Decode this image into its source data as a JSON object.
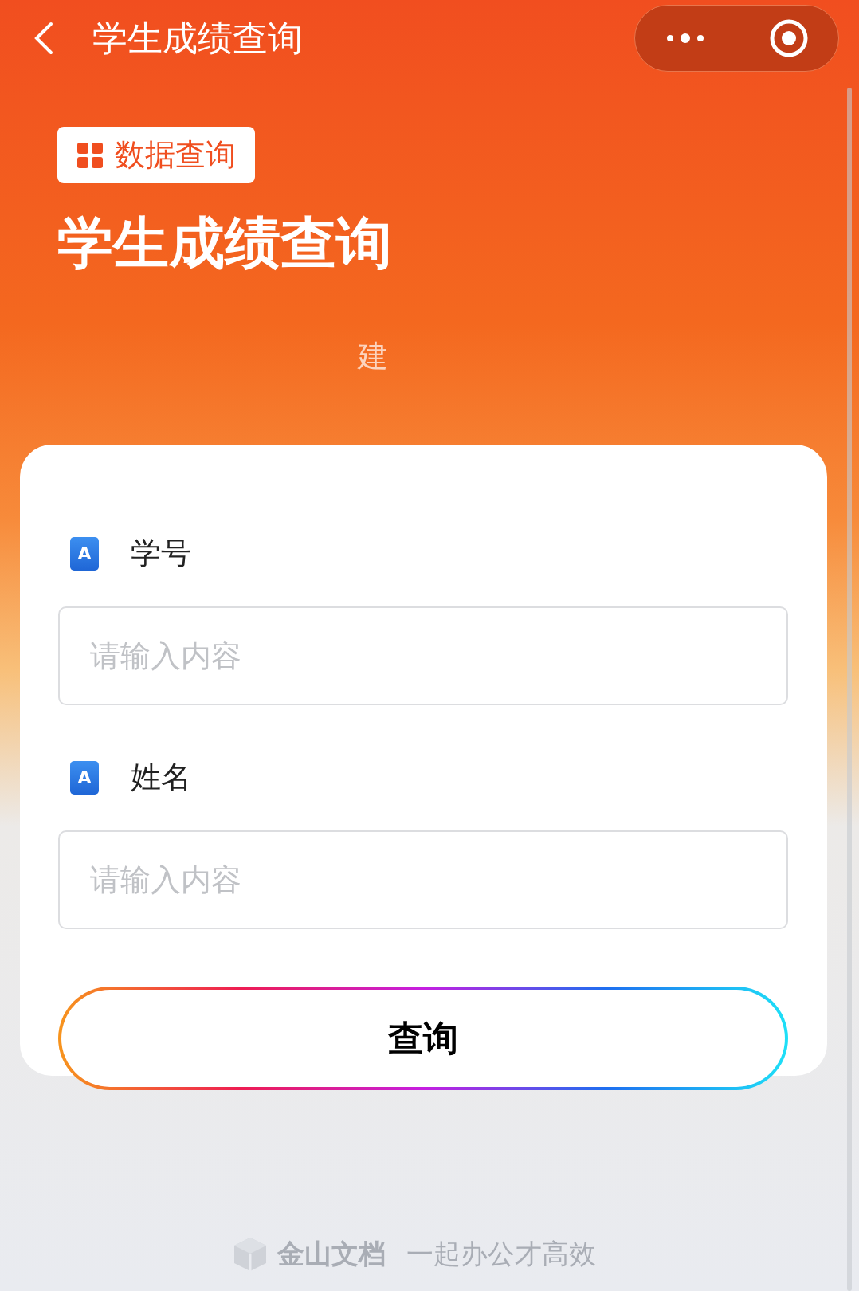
{
  "nav": {
    "title": "学生成绩查询"
  },
  "badge": "数据查询",
  "title": "学生成绩查询",
  "subtitle": "建",
  "fields": [
    {
      "icon_glyph": "A",
      "label": "学号",
      "placeholder": "请输入内容"
    },
    {
      "icon_glyph": "A",
      "label": "姓名",
      "placeholder": "请输入内容"
    }
  ],
  "button": "查询",
  "footer": {
    "brand": "金山文档",
    "slogan": "一起办公才高效"
  }
}
